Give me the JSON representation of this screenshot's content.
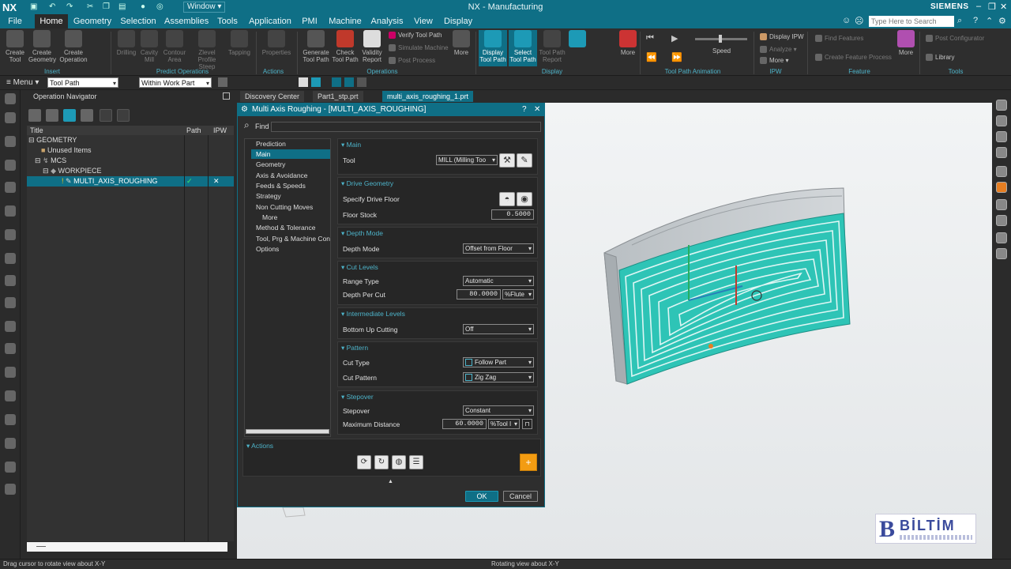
{
  "app": {
    "logo": "NX",
    "title": "NX - Manufacturing",
    "window_menu": "Window ▾",
    "brand": "SIEMENS",
    "search_placeholder": "Type Here to Search"
  },
  "menu_tabs": [
    "File",
    "Home",
    "Geometry",
    "Selection",
    "Assemblies",
    "Tools",
    "Application",
    "PMI",
    "Machine",
    "Analysis",
    "View",
    "Display"
  ],
  "ribbon": {
    "insert": {
      "group": "Insert",
      "buttons": [
        "Create Tool",
        "Create Geometry",
        "Create Operation"
      ]
    },
    "predict": {
      "group": "Predict Operations",
      "buttons": [
        "Drilling",
        "Cavity Mill",
        "Contour Area",
        "Zlevel Profile Steep",
        "Tapping"
      ]
    },
    "actions": {
      "group": "Actions",
      "buttons": [
        "Properties"
      ]
    },
    "operations": {
      "group": "Operations",
      "buttons": [
        "Generate Tool Path",
        "Check Tool Path",
        "Validity Report"
      ],
      "small": [
        "Verify Tool Path",
        "Simulate Machine",
        "Post Process"
      ],
      "more": "More"
    },
    "display": {
      "group": "Display",
      "buttons": [
        "Display Tool Path",
        "Select Tool Path",
        "Tool Path Report"
      ]
    },
    "animation": {
      "group": "Tool Path Animation",
      "more": "More",
      "speed_label": "Speed"
    },
    "ipw": {
      "group": "IPW",
      "small": [
        "Display IPW",
        "Analyze ▾",
        "More ▾"
      ]
    },
    "feature": {
      "group": "Feature",
      "small": [
        "Find Features",
        "Create Feature Process"
      ],
      "more": "More"
    },
    "tools": {
      "group": "Tools",
      "small": [
        "Post Configurator",
        "Library"
      ]
    }
  },
  "toolbar2": {
    "menu": "Menu ▾",
    "filter": "Tool Path",
    "scope": "Within Work Part Only"
  },
  "doc_tabs": [
    "Discovery Center",
    "Part1_stp.prt",
    "multi_axis_roughing_1.prt"
  ],
  "navigator": {
    "title": "Operation Navigator",
    "columns": [
      "Title",
      "Path",
      "IPW"
    ],
    "rows": [
      {
        "label": "GEOMETRY"
      },
      {
        "label": "Unused Items"
      },
      {
        "label": "MCS"
      },
      {
        "label": "WORKPIECE"
      },
      {
        "label": "MULTI_AXIS_ROUGHING",
        "path": "✓",
        "ipw": "✕"
      }
    ]
  },
  "dialog": {
    "title": "Multi Axis Roughing - [MULTI_AXIS_ROUGHING]",
    "help": "?",
    "close": "✕",
    "find_label": "Find",
    "nav": [
      "Prediction",
      "Main",
      "Geometry",
      "Axis & Avoidance",
      "Feeds & Speeds",
      "Strategy",
      "Non Cutting Moves",
      "More",
      "Method & Tolerance",
      "Tool, Prg & Machine Contr",
      "Options"
    ],
    "sections": {
      "main": {
        "title": "Main",
        "tool_label": "Tool",
        "tool_value": "MILL (Milling Too"
      },
      "drive": {
        "title": "Drive Geometry",
        "floor_label": "Specify Drive Floor",
        "stock_label": "Floor Stock",
        "stock_value": "0.5000"
      },
      "depth": {
        "title": "Depth Mode",
        "label": "Depth Mode",
        "value": "Offset from Floor"
      },
      "cut": {
        "title": "Cut Levels",
        "range_label": "Range Type",
        "range_value": "Automatic",
        "depth_label": "Depth Per Cut",
        "depth_value": "80.0000",
        "depth_unit": "%Flute"
      },
      "inter": {
        "title": "Intermediate Levels",
        "label": "Bottom Up Cutting",
        "value": "Off"
      },
      "pattern": {
        "title": "Pattern",
        "type_label": "Cut Type",
        "type_value": "Follow Part",
        "pattern_label": "Cut Pattern",
        "pattern_value": "Zig Zag"
      },
      "stepover": {
        "title": "Stepover",
        "label": "Stepover",
        "value": "Constant",
        "max_label": "Maximum Distance",
        "max_value": "60.0000",
        "max_unit": "%Tool I"
      }
    },
    "actions_title": "Actions",
    "ok": "OK",
    "cancel": "Cancel"
  },
  "status": {
    "left": "Drag cursor to rotate view about X-Y",
    "center": "Rotating view about X-Y"
  },
  "watermark": "BİLTİM",
  "colors": {
    "accent": "#0f6f86",
    "toolpath": "#2ec4b6",
    "link": "#4db3c9"
  }
}
